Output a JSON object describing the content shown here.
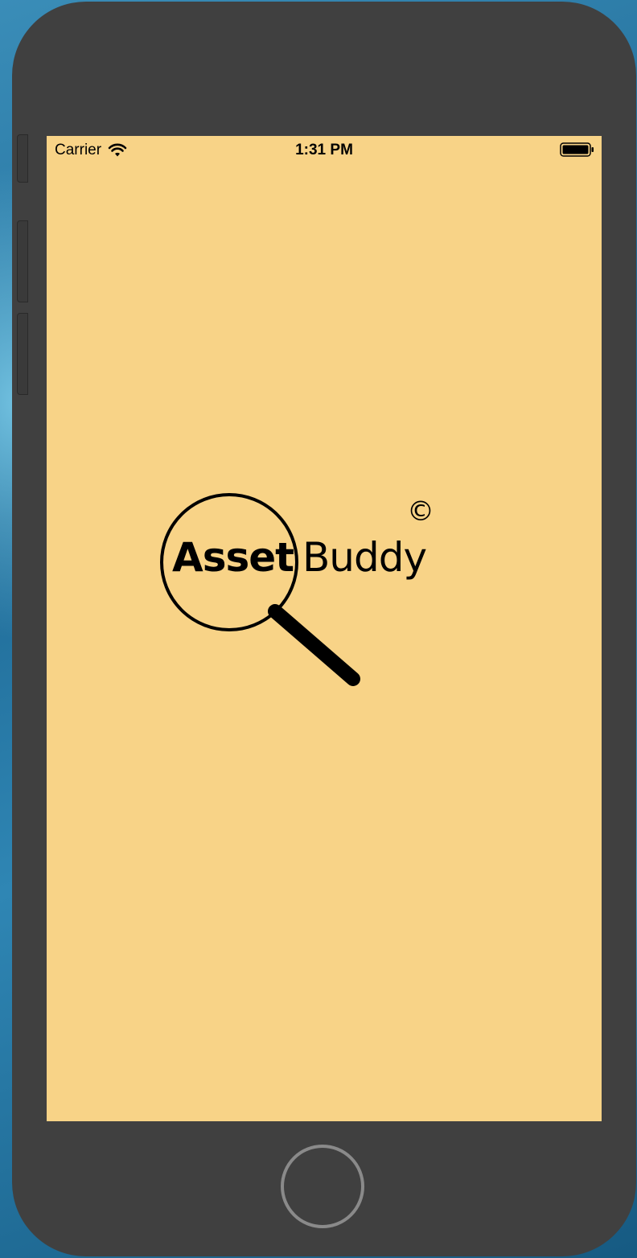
{
  "status_bar": {
    "carrier": "Carrier",
    "time": "1:31 PM",
    "wifi_icon": "wifi-icon",
    "battery_icon": "battery-full-icon"
  },
  "splash": {
    "logo_word_bold": "Asset",
    "logo_word_regular": "Buddy",
    "logo_mark": "©",
    "logo_icon": "magnifying-glass-icon"
  },
  "device": {
    "home_button_icon": "home-button-icon"
  },
  "colors": {
    "screen_background": "#f8d387",
    "device_body": "#404040",
    "logo": "#000000"
  }
}
